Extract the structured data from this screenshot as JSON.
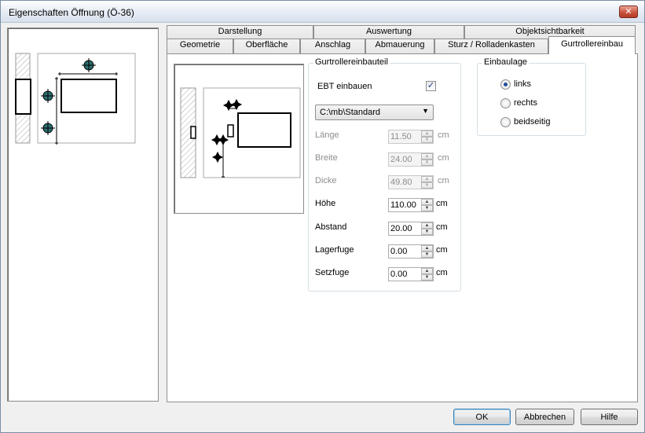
{
  "window": {
    "title": "Eigenschaften Öffnung (Ö-36)",
    "close_label": "✕"
  },
  "tabs_row1": [
    "Darstellung",
    "Auswertung",
    "Objektsichtbarkeit"
  ],
  "tabs_row2": [
    "Geometrie",
    "Oberfläche",
    "Anschlag",
    "Abmauerung",
    "Sturz / Rolladenkasten",
    "Gurtrollereinbau"
  ],
  "gurt_group": {
    "title": "Gurtrollereinbauteil",
    "ebt_label": "EBT einbauen",
    "ebt_checked": "✓",
    "select_value": "C:\\mb\\Standard",
    "select_arrow": "▼",
    "fields": [
      {
        "label": "Länge",
        "value": "11.50",
        "unit": "cm",
        "disabled": true
      },
      {
        "label": "Breite",
        "value": "24.00",
        "unit": "cm",
        "disabled": true
      },
      {
        "label": "Dicke",
        "value": "49.80",
        "unit": "cm",
        "disabled": true
      },
      {
        "label": "Höhe",
        "value": "110.00",
        "unit": "cm",
        "disabled": false
      },
      {
        "label": "Abstand",
        "value": "20.00",
        "unit": "cm",
        "disabled": false
      },
      {
        "label": "Lagerfuge",
        "value": "0.00",
        "unit": "cm",
        "disabled": false
      },
      {
        "label": "Setzfuge",
        "value": "0.00",
        "unit": "cm",
        "disabled": false
      }
    ]
  },
  "einbaulage": {
    "title": "Einbaulage",
    "options": [
      "links",
      "rechts",
      "beidseitig"
    ],
    "selected": "links"
  },
  "buttons": {
    "ok": "OK",
    "cancel": "Abbrechen",
    "help": "Hilfe"
  },
  "colors": {
    "marker_fill": "#2e6e6e",
    "accent": "#1f4e9b"
  }
}
